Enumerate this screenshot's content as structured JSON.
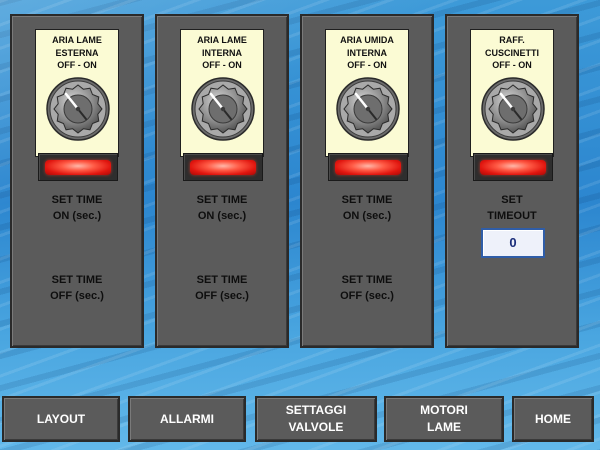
{
  "panels": [
    {
      "switch_title": "ARIA LAME\nESTERNA\nOFF  -  ON",
      "set_on_label": "SET TIME\nON (sec.)",
      "set_off_label": "SET TIME\nOFF (sec.)"
    },
    {
      "switch_title": "ARIA LAME\nINTERNA\nOFF  -  ON",
      "set_on_label": "SET TIME\nON (sec.)",
      "set_off_label": "SET TIME\nOFF (sec.)"
    },
    {
      "switch_title": "ARIA UMIDA\nINTERNA\nOFF  -  ON",
      "set_on_label": "SET TIME\nON (sec.)",
      "set_off_label": "SET TIME\nOFF (sec.)"
    },
    {
      "switch_title": "RAFF.\nCUSCINETTI\nOFF  -  ON",
      "timeout_label": "SET\nTIMEOUT",
      "timeout_value": "0"
    }
  ],
  "switch_state": "off",
  "lamp_color": "#e1160f",
  "nav": {
    "layout": "LAYOUT",
    "allarmi": "ALLARMI",
    "settaggi_valvole": "SETTAGGI\nVALVOLE",
    "motori_lame": "MOTORI\nLAME",
    "home": "HOME"
  },
  "icons": {
    "selector": "rotary-selector-switch-icon",
    "lamp": "indicator-lamp-icon"
  }
}
